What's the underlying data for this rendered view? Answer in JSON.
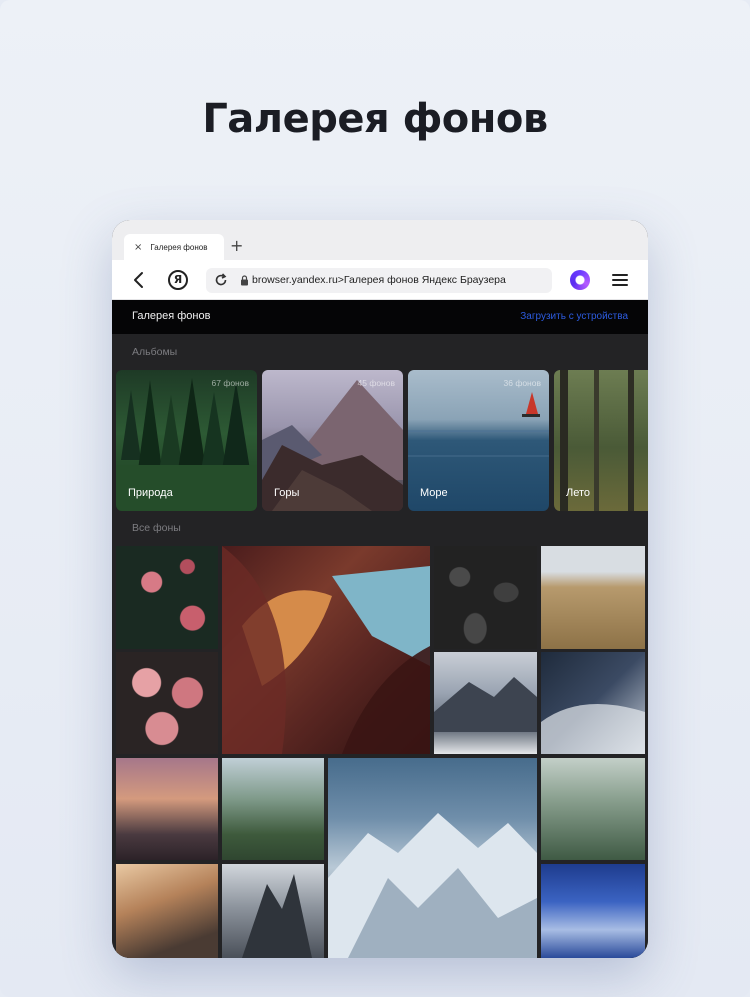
{
  "promo": {
    "title": "Галерея фонов"
  },
  "browser": {
    "tab": {
      "close_glyph": "×",
      "title": "Галерея фонов"
    },
    "new_tab_glyph": "+",
    "url": "browser.yandex.ru>Галерея фонов Яндекс Браузера",
    "yandex_button_letter": "Я",
    "icons": [
      "back-icon",
      "yandex-icon",
      "reload-icon",
      "lock-icon",
      "alice-icon",
      "menu-icon"
    ]
  },
  "page": {
    "title": "Галерея фонов",
    "upload_link": "Загрузить с устройства",
    "albums_label": "Альбомы",
    "all_label": "Все фоны",
    "albums": [
      {
        "name": "Природа",
        "count": "67 фонов"
      },
      {
        "name": "Горы",
        "count": "45 фонов"
      },
      {
        "name": "Море",
        "count": "36 фонов"
      },
      {
        "name": "Лето",
        "count": ""
      }
    ]
  },
  "colors": {
    "accent": "#2d5ce0",
    "alice": "#6a3cff",
    "page_bg": "#e6ebf4",
    "gallery_bg": "#232325"
  }
}
